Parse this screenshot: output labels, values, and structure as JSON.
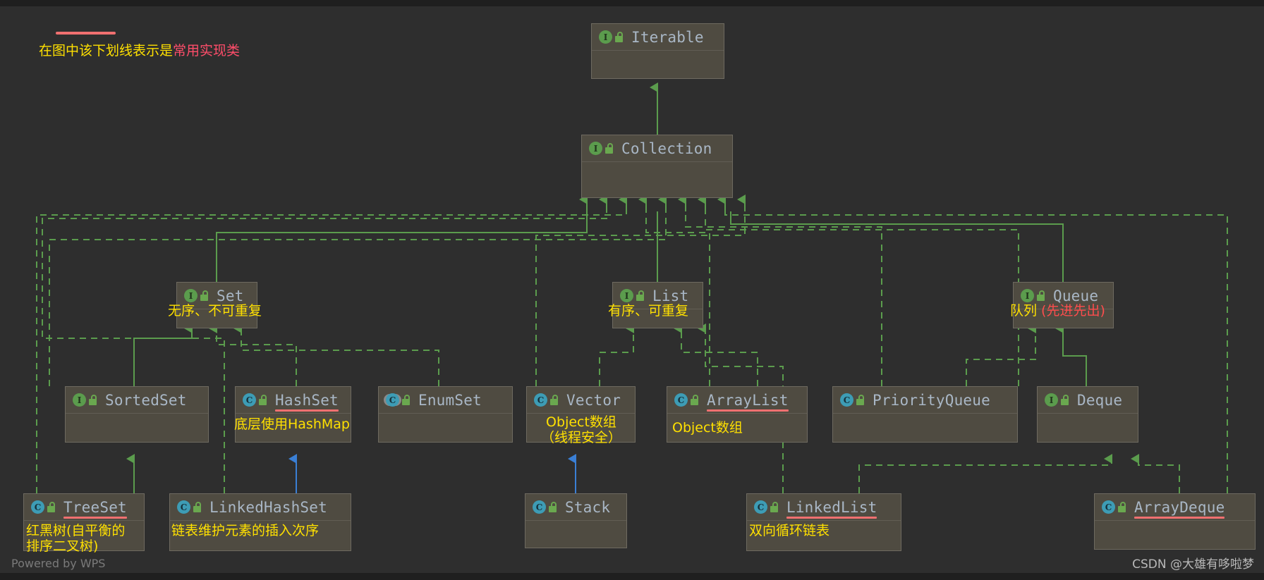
{
  "legend": {
    "prefix": "在图中该下划线表示是",
    "highlight": "常用实现类"
  },
  "watermarks": {
    "left": "Powered by WPS",
    "right": "CSDN @大雄有哆啦梦"
  },
  "colors": {
    "background": "#2e2e2e",
    "node_fill": "#4f4b41",
    "node_border": "#6e6a60",
    "class_name": "#a9b7c6",
    "interface_badge": "#5b9c4d",
    "class_badge": "#3d9cb5",
    "underline_red": "#f07070",
    "annotation_yellow": "#ffe000",
    "annotation_red": "#ff4d4d",
    "edge_green": "#5b9c4d",
    "edge_blue": "#3a7fd5"
  },
  "nodes": [
    {
      "id": "iterable",
      "name": "Iterable",
      "kind": "interface",
      "underline": false,
      "annotation": []
    },
    {
      "id": "collection",
      "name": "Collection",
      "kind": "interface",
      "underline": false,
      "annotation": []
    },
    {
      "id": "set",
      "name": "Set",
      "kind": "interface",
      "underline": false,
      "annotation": [
        {
          "text": "无序、不可重复",
          "color": "yellow"
        }
      ]
    },
    {
      "id": "list",
      "name": "List",
      "kind": "interface",
      "underline": false,
      "annotation": [
        {
          "text": "有序、可重复",
          "color": "yellow"
        }
      ]
    },
    {
      "id": "queue",
      "name": "Queue",
      "kind": "interface",
      "underline": false,
      "annotation": [
        {
          "text": "队列 ",
          "color": "yellow"
        },
        {
          "text": "(先进先出)",
          "color": "red"
        }
      ]
    },
    {
      "id": "sortedset",
      "name": "SortedSet",
      "kind": "interface",
      "underline": false,
      "annotation": []
    },
    {
      "id": "hashset",
      "name": "HashSet",
      "kind": "class",
      "underline": true,
      "annotation": [
        {
          "text": "底层使用HashMap",
          "color": "yellow"
        }
      ]
    },
    {
      "id": "enumset",
      "name": "EnumSet",
      "kind": "abstract",
      "underline": false,
      "annotation": []
    },
    {
      "id": "vector",
      "name": "Vector",
      "kind": "class",
      "underline": false,
      "annotation": [
        {
          "text": "Object数组",
          "color": "yellow"
        },
        {
          "text": "（线程安全）",
          "color": "yellow"
        }
      ]
    },
    {
      "id": "arraylist",
      "name": "ArrayList",
      "kind": "class",
      "underline": true,
      "annotation": [
        {
          "text": "Object数组",
          "color": "yellow"
        }
      ]
    },
    {
      "id": "priorityqueue",
      "name": "PriorityQueue",
      "kind": "class",
      "underline": false,
      "annotation": []
    },
    {
      "id": "deque",
      "name": "Deque",
      "kind": "interface",
      "underline": false,
      "annotation": []
    },
    {
      "id": "treeset",
      "name": "TreeSet",
      "kind": "class",
      "underline": true,
      "annotation": [
        {
          "text": "红黑树(自平衡的",
          "color": "yellow"
        },
        {
          "text": "排序二叉树)",
          "color": "yellow"
        }
      ]
    },
    {
      "id": "linkedhashset",
      "name": "LinkedHashSet",
      "kind": "class",
      "underline": false,
      "annotation": [
        {
          "text": "链表维护元素的插入次序",
          "color": "yellow"
        }
      ]
    },
    {
      "id": "stack",
      "name": "Stack",
      "kind": "class",
      "underline": false,
      "annotation": []
    },
    {
      "id": "linkedlist",
      "name": "LinkedList",
      "kind": "class",
      "underline": true,
      "annotation": [
        {
          "text": "双向循环链表",
          "color": "yellow"
        }
      ]
    },
    {
      "id": "arraydeque",
      "name": "ArrayDeque",
      "kind": "class",
      "underline": true,
      "annotation": []
    }
  ],
  "edges": [
    {
      "from": "collection",
      "to": "iterable",
      "style": "solid",
      "color": "green"
    },
    {
      "from": "set",
      "to": "collection",
      "style": "solid",
      "color": "green"
    },
    {
      "from": "list",
      "to": "collection",
      "style": "solid",
      "color": "green"
    },
    {
      "from": "queue",
      "to": "collection",
      "style": "solid",
      "color": "green"
    },
    {
      "from": "sortedset",
      "to": "set",
      "style": "solid",
      "color": "green"
    },
    {
      "from": "hashset",
      "to": "set",
      "style": "dashed",
      "color": "green"
    },
    {
      "from": "enumset",
      "to": "set",
      "style": "dashed",
      "color": "green"
    },
    {
      "from": "treeset",
      "to": "sortedset",
      "style": "solid",
      "color": "green"
    },
    {
      "from": "linkedhashset",
      "to": "hashset",
      "style": "solid",
      "color": "blue"
    },
    {
      "from": "vector",
      "to": "list",
      "style": "dashed",
      "color": "green"
    },
    {
      "from": "arraylist",
      "to": "list",
      "style": "dashed",
      "color": "green"
    },
    {
      "from": "linkedlist",
      "to": "list",
      "style": "dashed",
      "color": "green"
    },
    {
      "from": "stack",
      "to": "vector",
      "style": "solid",
      "color": "blue"
    },
    {
      "from": "priorityqueue",
      "to": "queue",
      "style": "dashed",
      "color": "green"
    },
    {
      "from": "deque",
      "to": "queue",
      "style": "solid",
      "color": "green"
    },
    {
      "from": "linkedlist",
      "to": "deque",
      "style": "dashed",
      "color": "green"
    },
    {
      "from": "arraydeque",
      "to": "deque",
      "style": "dashed",
      "color": "green"
    }
  ]
}
